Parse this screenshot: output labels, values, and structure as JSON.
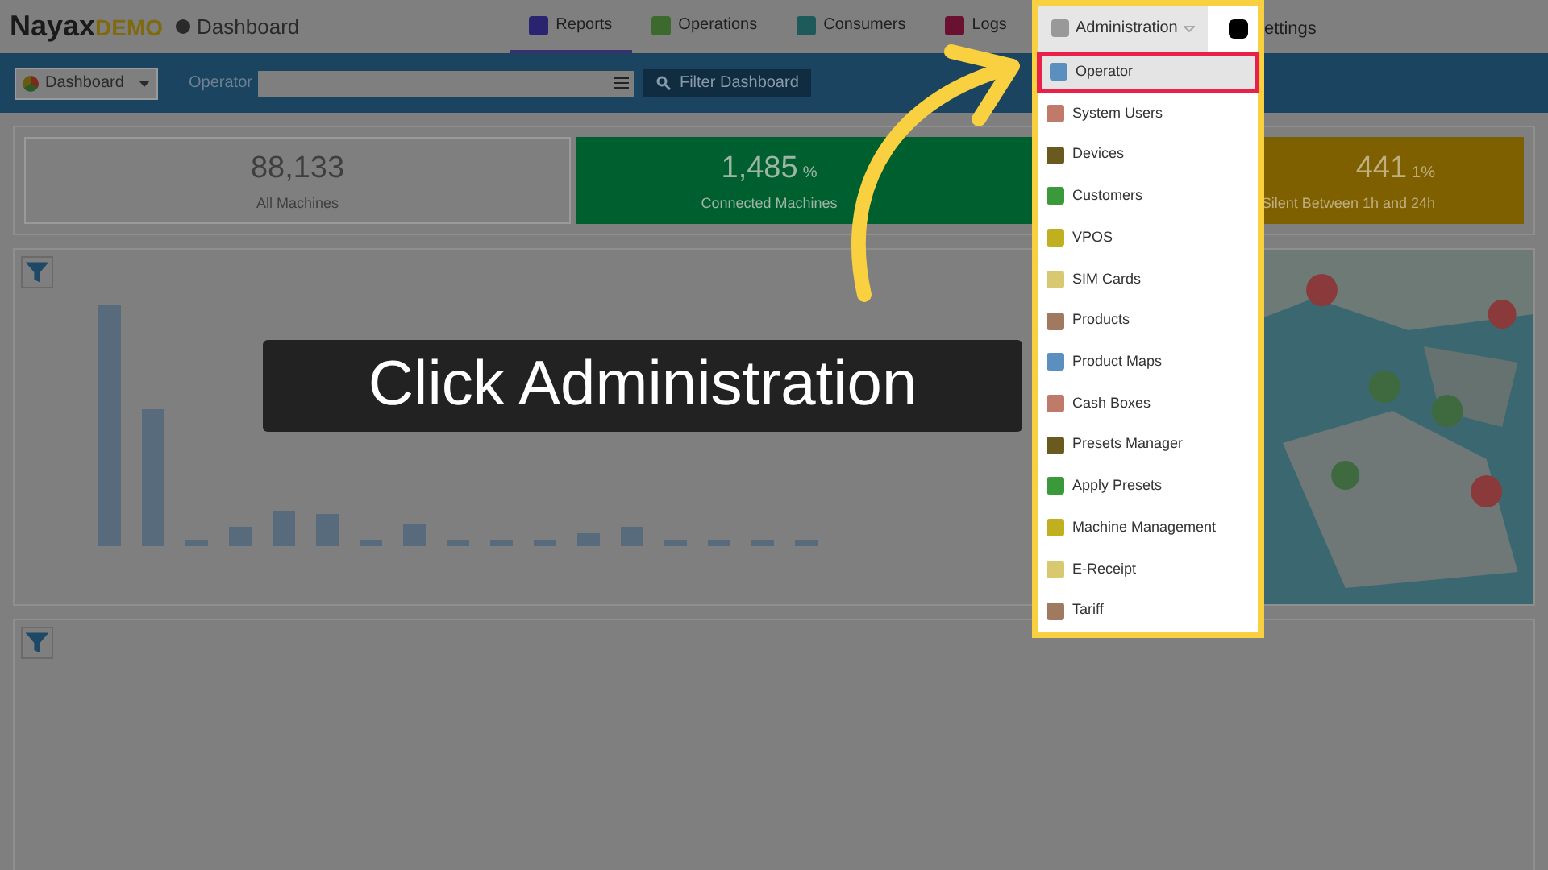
{
  "header": {
    "logo": "Nayax",
    "logo_suffix": "DEMO",
    "page_title": "Dashboard",
    "nav": [
      {
        "label": "Reports",
        "selected": true
      },
      {
        "label": "Operations",
        "selected": false
      },
      {
        "label": "Consumers",
        "selected": false
      },
      {
        "label": "Logs",
        "selected": false
      }
    ],
    "settings_label": "ettings"
  },
  "admin_menu": {
    "label": "Administration",
    "expanded": true,
    "items": [
      {
        "label": "Operator",
        "selected": true
      },
      {
        "label": "System Users",
        "selected": false
      },
      {
        "label": "Devices",
        "selected": false
      },
      {
        "label": "Customers",
        "selected": false
      },
      {
        "label": "VPOS",
        "selected": false
      },
      {
        "label": "SIM Cards",
        "selected": false
      },
      {
        "label": "Products",
        "selected": false
      },
      {
        "label": "Product Maps",
        "selected": false
      },
      {
        "label": "Cash Boxes",
        "selected": false
      },
      {
        "label": "Presets Manager",
        "selected": false
      },
      {
        "label": "Apply Presets",
        "selected": false
      },
      {
        "label": "Machine Management",
        "selected": false
      },
      {
        "label": "E-Receipt",
        "selected": false
      },
      {
        "label": "Tariff",
        "selected": false
      }
    ]
  },
  "toolbar": {
    "view": "Dashboard",
    "operator_label": "Operator",
    "filter_button": "Filter Dashboard"
  },
  "stats": [
    {
      "kind": "neutral",
      "value": "88,133",
      "label": "All Machines"
    },
    {
      "kind": "connected",
      "value": "1,485",
      "percent": "%",
      "label": "Connected Machines"
    },
    {
      "kind": "silent",
      "value": "441",
      "percent": "1%",
      "label": "Silent Between 1h and 24h"
    }
  ],
  "caption": "Click Administration"
}
